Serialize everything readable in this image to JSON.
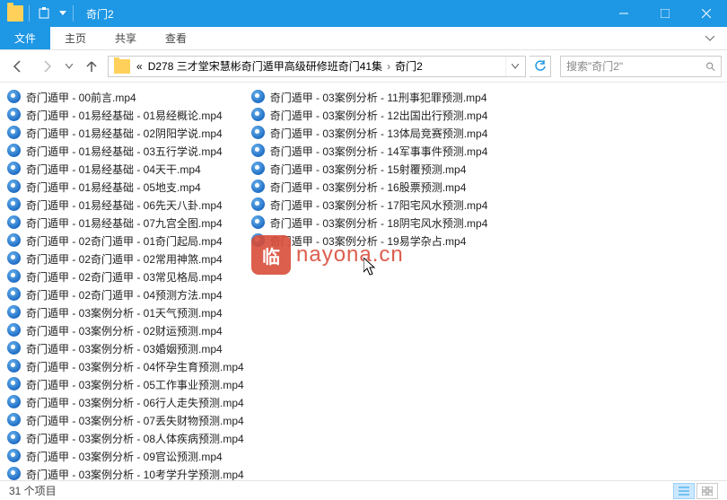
{
  "window": {
    "title": "奇门2"
  },
  "ribbon": {
    "file": "文件",
    "tabs": [
      "主页",
      "共享",
      "查看"
    ]
  },
  "breadcrumb": {
    "prefix": "«",
    "parts": [
      "D278 三才堂宋慧彬奇门遁甲高级研修班奇门41集",
      "奇门2"
    ]
  },
  "search": {
    "placeholder": "搜索\"奇门2\"",
    "icon": "search-icon"
  },
  "files_col1": [
    "奇门遁甲 - 00前言.mp4",
    "奇门遁甲 - 01易经基础 - 01易经概论.mp4",
    "奇门遁甲 - 01易经基础 - 02阴阳学说.mp4",
    "奇门遁甲 - 01易经基础 - 03五行学说.mp4",
    "奇门遁甲 - 01易经基础 - 04天干.mp4",
    "奇门遁甲 - 01易经基础 - 05地支.mp4",
    "奇门遁甲 - 01易经基础 - 06先天八卦.mp4",
    "奇门遁甲 - 01易经基础 - 07九宫全图.mp4",
    "奇门遁甲 - 02奇门遁甲 - 01奇门起局.mp4",
    "奇门遁甲 - 02奇门遁甲 - 02常用神煞.mp4",
    "奇门遁甲 - 02奇门遁甲 - 03常见格局.mp4",
    "奇门遁甲 - 02奇门遁甲 - 04预测方法.mp4",
    "奇门遁甲 - 03案例分析 - 01天气预测.mp4",
    "奇门遁甲 - 03案例分析 - 02财运预测.mp4",
    "奇门遁甲 - 03案例分析 - 03婚姻预测.mp4",
    "奇门遁甲 - 03案例分析 - 04怀孕生育预测.mp4",
    "奇门遁甲 - 03案例分析 - 05工作事业预测.mp4",
    "奇门遁甲 - 03案例分析 - 06行人走失预测.mp4",
    "奇门遁甲 - 03案例分析 - 07丢失财物预测.mp4",
    "奇门遁甲 - 03案例分析 - 08人体疾病预测.mp4",
    "奇门遁甲 - 03案例分析 - 09官讼预测.mp4",
    "奇门遁甲 - 03案例分析 - 10考学升学预测.mp4"
  ],
  "files_col2": [
    "奇门遁甲 - 03案例分析 - 11刑事犯罪预测.mp4",
    "奇门遁甲 - 03案例分析 - 12出国出行预测.mp4",
    "奇门遁甲 - 03案例分析 - 13体局竞赛预测.mp4",
    "奇门遁甲 - 03案例分析 - 14军事事件预测.mp4",
    "奇门遁甲 - 03案例分析 - 15射覆预测.mp4",
    "奇门遁甲 - 03案例分析 - 16股票预测.mp4",
    "奇门遁甲 - 03案例分析 - 17阳宅风水预测.mp4",
    "奇门遁甲 - 03案例分析 - 18阴宅风水预测.mp4",
    "奇门遁甲 - 03案例分析 - 19易学杂占.mp4"
  ],
  "watermark": {
    "seal": "临",
    "text": "nayona.cn"
  },
  "status": {
    "count": "31 个项目"
  }
}
